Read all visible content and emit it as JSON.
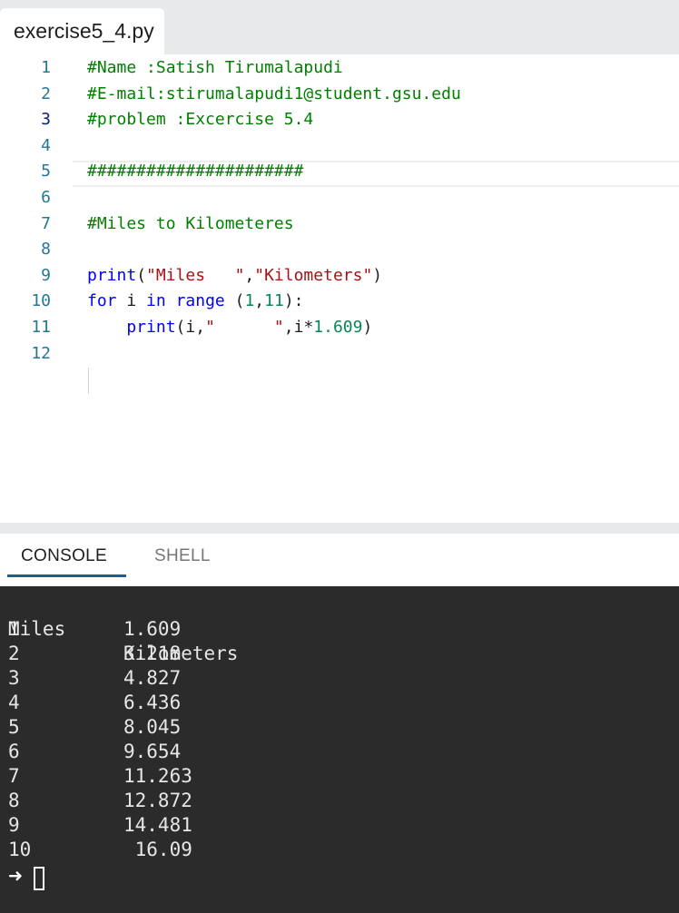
{
  "file_tab": {
    "name": "exercise5_4.py"
  },
  "editor": {
    "lines": [
      {
        "no": "1",
        "segments": [
          {
            "t": "comment",
            "text": "#Name :Satish Tirumalapudi"
          }
        ]
      },
      {
        "no": "2",
        "segments": [
          {
            "t": "comment",
            "text": "#E-mail:stirumalapudi1@student.gsu.edu"
          }
        ]
      },
      {
        "no": "3",
        "segments": [
          {
            "t": "comment",
            "text": "#problem :Excercise 5.4"
          }
        ]
      },
      {
        "no": "4",
        "segments": []
      },
      {
        "no": "5",
        "segments": [
          {
            "t": "comment",
            "text": "######################"
          }
        ]
      },
      {
        "no": "6",
        "segments": []
      },
      {
        "no": "7",
        "segments": [
          {
            "t": "comment",
            "text": "#Miles to Kilometeres"
          }
        ]
      },
      {
        "no": "8",
        "segments": []
      },
      {
        "no": "9",
        "segments": [
          {
            "t": "fn",
            "text": "print"
          },
          {
            "t": "plain",
            "text": "("
          },
          {
            "t": "str",
            "text": "\"Miles   \""
          },
          {
            "t": "plain",
            "text": ","
          },
          {
            "t": "str",
            "text": "\"Kilometers\""
          },
          {
            "t": "plain",
            "text": ")"
          }
        ]
      },
      {
        "no": "10",
        "segments": [
          {
            "t": "kw",
            "text": "for"
          },
          {
            "t": "plain",
            "text": " i "
          },
          {
            "t": "kw",
            "text": "in"
          },
          {
            "t": "plain",
            "text": " "
          },
          {
            "t": "fn",
            "text": "range"
          },
          {
            "t": "plain",
            "text": " ("
          },
          {
            "t": "num",
            "text": "1"
          },
          {
            "t": "plain",
            "text": ","
          },
          {
            "t": "num",
            "text": "11"
          },
          {
            "t": "plain",
            "text": "):"
          }
        ]
      },
      {
        "no": "11",
        "segments": [
          {
            "t": "plain",
            "text": "    "
          },
          {
            "t": "fn",
            "text": "print"
          },
          {
            "t": "plain",
            "text": "(i,"
          },
          {
            "t": "str",
            "text": "\"      \""
          },
          {
            "t": "plain",
            "text": ",i*"
          },
          {
            "t": "num",
            "text": "1.609"
          },
          {
            "t": "plain",
            "text": ")"
          }
        ]
      },
      {
        "no": "12",
        "segments": []
      }
    ]
  },
  "console_tabs": {
    "console_label": "CONSOLE",
    "shell_label": "SHELL"
  },
  "console": {
    "header": {
      "miles": "Miles",
      "km": "Kilometers"
    },
    "rows": [
      {
        "miles": "1",
        "km": "1.609"
      },
      {
        "miles": "2",
        "km": "3.218"
      },
      {
        "miles": "3",
        "km": "4.827"
      },
      {
        "miles": "4",
        "km": "6.436"
      },
      {
        "miles": "5",
        "km": "8.045"
      },
      {
        "miles": "6",
        "km": "9.654"
      },
      {
        "miles": "7",
        "km": "11.263"
      },
      {
        "miles": "8",
        "km": "12.872"
      },
      {
        "miles": "9",
        "km": "14.481"
      },
      {
        "miles": "10",
        "km": " 16.09"
      }
    ],
    "prompt_symbol": "➜"
  }
}
